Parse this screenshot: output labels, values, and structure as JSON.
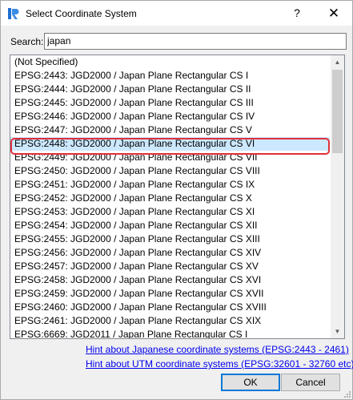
{
  "window": {
    "title": "Select Coordinate System",
    "help_glyph": "?",
    "close_glyph": "✕",
    "app_icon": "riri-app-icon"
  },
  "search": {
    "label": "Search:",
    "value": "japan",
    "placeholder": ""
  },
  "list": {
    "items": [
      "(Not Specified)",
      "EPSG:2443: JGD2000 / Japan Plane Rectangular CS I",
      "EPSG:2444: JGD2000 / Japan Plane Rectangular CS II",
      "EPSG:2445: JGD2000 / Japan Plane Rectangular CS III",
      "EPSG:2446: JGD2000 / Japan Plane Rectangular CS IV",
      "EPSG:2447: JGD2000 / Japan Plane Rectangular CS V",
      "EPSG:2448: JGD2000 / Japan Plane Rectangular CS VI",
      "EPSG:2449: JGD2000 / Japan Plane Rectangular CS VII",
      "EPSG:2450: JGD2000 / Japan Plane Rectangular CS VIII",
      "EPSG:2451: JGD2000 / Japan Plane Rectangular CS IX",
      "EPSG:2452: JGD2000 / Japan Plane Rectangular CS X",
      "EPSG:2453: JGD2000 / Japan Plane Rectangular CS XI",
      "EPSG:2454: JGD2000 / Japan Plane Rectangular CS XII",
      "EPSG:2455: JGD2000 / Japan Plane Rectangular CS XIII",
      "EPSG:2456: JGD2000 / Japan Plane Rectangular CS XIV",
      "EPSG:2457: JGD2000 / Japan Plane Rectangular CS XV",
      "EPSG:2458: JGD2000 / Japan Plane Rectangular CS XVI",
      "EPSG:2459: JGD2000 / Japan Plane Rectangular CS XVII",
      "EPSG:2460: JGD2000 / Japan Plane Rectangular CS XVIII",
      "EPSG:2461: JGD2000 / Japan Plane Rectangular CS XIX",
      "EPSG:6669: JGD2011 / Japan Plane Rectangular CS I"
    ],
    "selected_index": 6,
    "selection_color": "#cce8ff",
    "highlight_color": "#e0303a"
  },
  "hints": {
    "japanese": "Hint about Japanese coordinate systems (EPSG:2443 - 2461)",
    "utm": "Hint about UTM coordinate systems (EPSG:32601 - 32760 etc)",
    "link_color": "#0000ee"
  },
  "buttons": {
    "ok": "OK",
    "cancel": "Cancel"
  }
}
